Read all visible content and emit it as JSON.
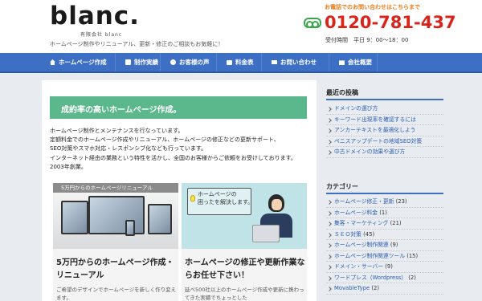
{
  "header": {
    "logo": "blanc.",
    "logo_sub": "有限会社 blanc",
    "tagline": "ホームページ制作やリニューアル、更新・修正のご相談もお気軽に！",
    "contact_heading": "お電話でのお問い合わせはこちらまで",
    "phone": "0120-781-437",
    "hours": "受付時間　平日 9：00～18：00"
  },
  "nav": {
    "items": [
      {
        "label": "ホームページ作成",
        "icon": "home-icon"
      },
      {
        "label": "制作実績",
        "icon": "document-icon"
      },
      {
        "label": "お客様の声",
        "icon": "speech-bubble-icon"
      },
      {
        "label": "料金表",
        "icon": "price-card-icon"
      },
      {
        "label": "お問い合わせ",
        "icon": "mail-icon"
      },
      {
        "label": "会社概要",
        "icon": "building-icon"
      }
    ]
  },
  "main": {
    "banner": "成約率の高いホームページ作成。",
    "intro": [
      "ホームページ制作とメンテナンスを行なっています。",
      "定額料金でのホームページ作成やリニューアル、ホームページの修正などの更新サポート、",
      "SEO対策やスマホ対応・レスポンシブ化なども行っています。",
      "インターネット経由の業務という特性を活かし、全国のお客様からご依頼をお受けしております。2003年創業。"
    ],
    "card1": {
      "caption": "5万円からのホームページリニューアル",
      "title": "5万円からのホームページ作成・リニューアル",
      "desc": "ご希望のデザインでホームページを新しく作り変えます。"
    },
    "card2": {
      "speech": "ホームページの\n困ったを解決します。",
      "title": "ホームページの修正や更新作業ならお任せ下さい！",
      "desc": "延べ500社以上のホームページ作成や更新に携わってきた実績でちょっとした"
    }
  },
  "sidebar": {
    "recent_title": "最近の投稿",
    "recent_posts": [
      "ドメインの選び方",
      "キーワード出現率を確認するには",
      "アンカーテキストを最適化しよう",
      "ペニスアップデートの地域SEO対策",
      "中古ドメインの効果や選び方"
    ],
    "categories_title": "カテゴリー",
    "categories": [
      {
        "label": "ホームページ修正・更新",
        "count": "(23)"
      },
      {
        "label": "ホームページ料金",
        "count": "(1)"
      },
      {
        "label": "集客・マーケティング",
        "count": "(21)"
      },
      {
        "label": "ＳＥＯ対策",
        "count": "(45)"
      },
      {
        "label": "ホームページ制作関連",
        "count": "(9)"
      },
      {
        "label": "ホームページ制作関連ツール",
        "count": "(15)"
      },
      {
        "label": "ドメイン・サーバー",
        "count": "(9)"
      },
      {
        "label": "ワードプレス（Wordpress）",
        "count": "(2)"
      },
      {
        "label": "MovableType",
        "count": "(2)"
      }
    ]
  },
  "colors": {
    "nav_blue": "#3d6fc4",
    "banner_green": "#5bb88c",
    "phone_red": "#d9231b",
    "contact_orange": "#e87d1e",
    "phone_icon_green": "#3aa64a",
    "link_blue": "#2a5db0"
  }
}
